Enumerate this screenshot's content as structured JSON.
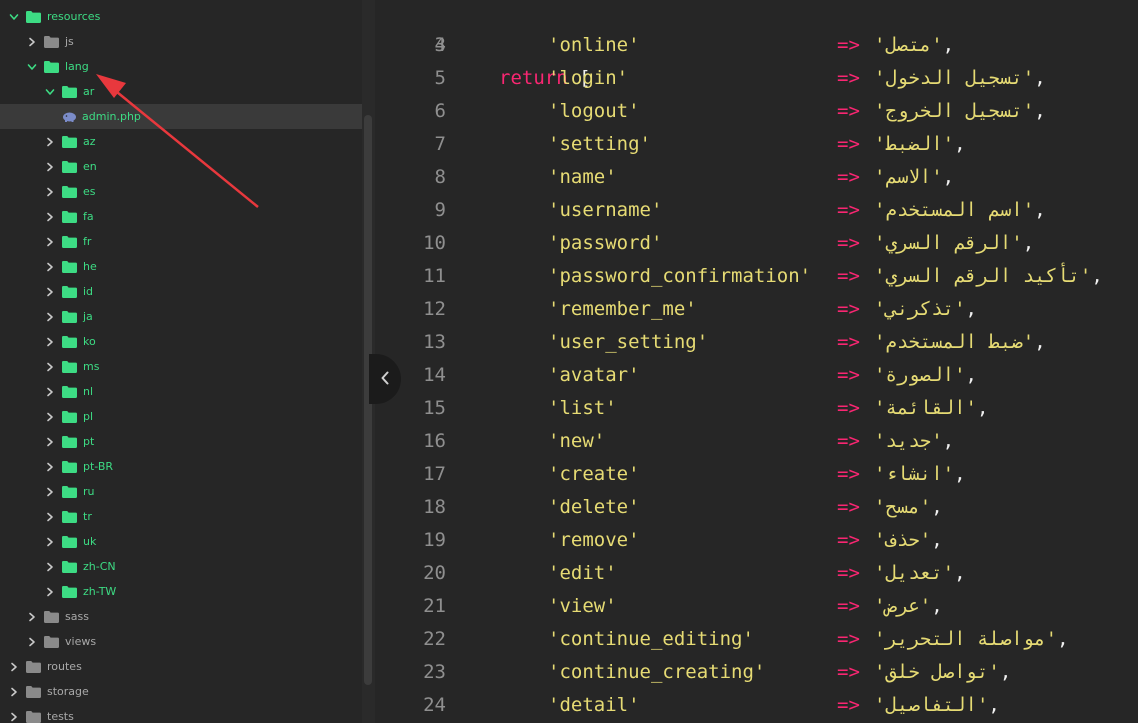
{
  "colors": {
    "background": "#262626",
    "folder_green": "#3ddc84",
    "folder_gray": "#8a8a8a",
    "keyword": "#f92672",
    "string": "#e6db74",
    "line_number": "#8f8f8f",
    "annotation_arrow": "#e8383d"
  },
  "sidebar": {
    "items": [
      {
        "label": "resources",
        "kind": "folder",
        "color": "green",
        "expanded": true,
        "icon": "folder-icon"
      },
      {
        "label": "js",
        "kind": "folder",
        "color": "gray",
        "expanded": false,
        "icon": "folder-icon"
      },
      {
        "label": "lang",
        "kind": "folder",
        "color": "green",
        "expanded": true,
        "icon": "folder-icon"
      },
      {
        "label": "ar",
        "kind": "folder",
        "color": "green",
        "expanded": true,
        "icon": "folder-icon"
      },
      {
        "label": "admin.php",
        "kind": "file",
        "color": "green",
        "selected": true,
        "icon": "php-elephant-icon"
      },
      {
        "label": "az",
        "kind": "folder",
        "color": "green",
        "expanded": false,
        "icon": "folder-icon"
      },
      {
        "label": "en",
        "kind": "folder",
        "color": "green",
        "expanded": false,
        "icon": "folder-icon"
      },
      {
        "label": "es",
        "kind": "folder",
        "color": "green",
        "expanded": false,
        "icon": "folder-icon"
      },
      {
        "label": "fa",
        "kind": "folder",
        "color": "green",
        "expanded": false,
        "icon": "folder-icon"
      },
      {
        "label": "fr",
        "kind": "folder",
        "color": "green",
        "expanded": false,
        "icon": "folder-icon"
      },
      {
        "label": "he",
        "kind": "folder",
        "color": "green",
        "expanded": false,
        "icon": "folder-icon"
      },
      {
        "label": "id",
        "kind": "folder",
        "color": "green",
        "expanded": false,
        "icon": "folder-icon"
      },
      {
        "label": "ja",
        "kind": "folder",
        "color": "green",
        "expanded": false,
        "icon": "folder-icon"
      },
      {
        "label": "ko",
        "kind": "folder",
        "color": "green",
        "expanded": false,
        "icon": "folder-icon"
      },
      {
        "label": "ms",
        "kind": "folder",
        "color": "green",
        "expanded": false,
        "icon": "folder-icon"
      },
      {
        "label": "nl",
        "kind": "folder",
        "color": "green",
        "expanded": false,
        "icon": "folder-icon"
      },
      {
        "label": "pl",
        "kind": "folder",
        "color": "green",
        "expanded": false,
        "icon": "folder-icon"
      },
      {
        "label": "pt",
        "kind": "folder",
        "color": "green",
        "expanded": false,
        "icon": "folder-icon"
      },
      {
        "label": "pt-BR",
        "kind": "folder",
        "color": "green",
        "expanded": false,
        "icon": "folder-icon"
      },
      {
        "label": "ru",
        "kind": "folder",
        "color": "green",
        "expanded": false,
        "icon": "folder-icon"
      },
      {
        "label": "tr",
        "kind": "folder",
        "color": "green",
        "expanded": false,
        "icon": "folder-icon"
      },
      {
        "label": "uk",
        "kind": "folder",
        "color": "green",
        "expanded": false,
        "icon": "folder-icon"
      },
      {
        "label": "zh-CN",
        "kind": "folder",
        "color": "green",
        "expanded": false,
        "icon": "folder-icon"
      },
      {
        "label": "zh-TW",
        "kind": "folder",
        "color": "green",
        "expanded": false,
        "icon": "folder-icon"
      },
      {
        "label": "sass",
        "kind": "folder",
        "color": "gray",
        "expanded": false,
        "icon": "folder-icon"
      },
      {
        "label": "views",
        "kind": "folder",
        "color": "gray",
        "expanded": false,
        "icon": "folder-icon"
      },
      {
        "label": "routes",
        "kind": "folder",
        "color": "gray",
        "expanded": false,
        "icon": "folder-icon"
      },
      {
        "label": "storage",
        "kind": "folder",
        "color": "gray",
        "expanded": false,
        "icon": "folder-icon"
      },
      {
        "label": "tests",
        "kind": "folder",
        "color": "gray",
        "expanded": false,
        "icon": "folder-icon"
      }
    ]
  },
  "editor": {
    "first_line": {
      "number": "3",
      "keyword": "return",
      "bracket": "["
    },
    "lines": [
      {
        "number": "4",
        "key": "'online'",
        "arrow": "=>",
        "value": "'متصل'",
        "comma": ","
      },
      {
        "number": "5",
        "key": "'login'",
        "arrow": "=>",
        "value": "'تسجيل الدخول'",
        "comma": ","
      },
      {
        "number": "6",
        "key": "'logout'",
        "arrow": "=>",
        "value": "'تسجيل الخروج'",
        "comma": ","
      },
      {
        "number": "7",
        "key": "'setting'",
        "arrow": "=>",
        "value": "'الضبط'",
        "comma": ","
      },
      {
        "number": "8",
        "key": "'name'",
        "arrow": "=>",
        "value": "'الاسم'",
        "comma": ","
      },
      {
        "number": "9",
        "key": "'username'",
        "arrow": "=>",
        "value": "'اسم المستخدم'",
        "comma": ","
      },
      {
        "number": "10",
        "key": "'password'",
        "arrow": "=>",
        "value": "'الرقم السري'",
        "comma": ","
      },
      {
        "number": "11",
        "key": "'password_confirmation'",
        "arrow": "=>",
        "value": "'تأكيد الرقم السري'",
        "comma": ","
      },
      {
        "number": "12",
        "key": "'remember_me'",
        "arrow": "=>",
        "value": "'تذكرني'",
        "comma": ","
      },
      {
        "number": "13",
        "key": "'user_setting'",
        "arrow": "=>",
        "value": "'ضبط المستخدم'",
        "comma": ","
      },
      {
        "number": "14",
        "key": "'avatar'",
        "arrow": "=>",
        "value": "'الصورة'",
        "comma": ","
      },
      {
        "number": "15",
        "key": "'list'",
        "arrow": "=>",
        "value": "'القائمة'",
        "comma": ","
      },
      {
        "number": "16",
        "key": "'new'",
        "arrow": "=>",
        "value": "'جديد'",
        "comma": ","
      },
      {
        "number": "17",
        "key": "'create'",
        "arrow": "=>",
        "value": "'انشاء'",
        "comma": ","
      },
      {
        "number": "18",
        "key": "'delete'",
        "arrow": "=>",
        "value": "'مسح'",
        "comma": ","
      },
      {
        "number": "19",
        "key": "'remove'",
        "arrow": "=>",
        "value": "'حذف'",
        "comma": ","
      },
      {
        "number": "20",
        "key": "'edit'",
        "arrow": "=>",
        "value": "'تعديل'",
        "comma": ","
      },
      {
        "number": "21",
        "key": "'view'",
        "arrow": "=>",
        "value": "'عرض'",
        "comma": ","
      },
      {
        "number": "22",
        "key": "'continue_editing'",
        "arrow": "=>",
        "value": "'مواصلة التحرير'",
        "comma": ","
      },
      {
        "number": "23",
        "key": "'continue_creating'",
        "arrow": "=>",
        "value": "'تواصل خلق'",
        "comma": ","
      },
      {
        "number": "24",
        "key": "'detail'",
        "arrow": "=>",
        "value": "'التفاصيل'",
        "comma": ","
      }
    ]
  }
}
